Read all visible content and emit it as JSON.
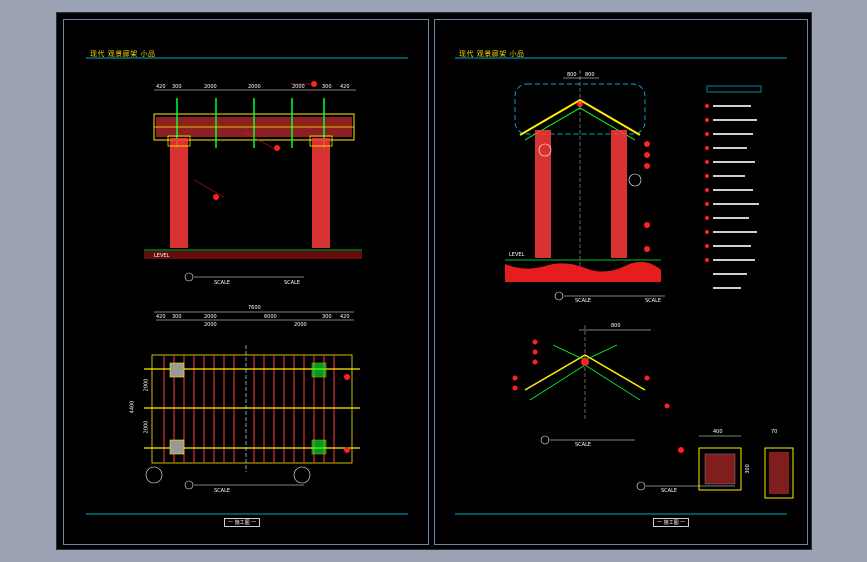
{
  "sheets": {
    "left": {
      "title_left": "现代 观景廊架 小品",
      "title_right": "",
      "elevation_dims_top": [
        "420",
        "300",
        "2000",
        "2000",
        "2000",
        "300",
        "420"
      ],
      "elevation_scale_label": "SCALE",
      "elevation_scale_label_2": "SCALE",
      "elevation_level": "LEVEL",
      "plan_dims_total": "7600",
      "plan_dims_top": [
        "420",
        "300",
        "2000",
        "6000",
        "300",
        "420"
      ],
      "plan_dims_sub": [
        "2000",
        "2000"
      ],
      "plan_left_dims": [
        "4400",
        "2000",
        "2000"
      ],
      "plan_scale_label": "SCALE",
      "footer": "一 施工图 一"
    },
    "right": {
      "title_left": "现代 观景廊架 小品",
      "title_right": "",
      "section_dims_top": [
        "800",
        "800"
      ],
      "section_level": "LEVEL",
      "section_scale_label": "SCALE",
      "section_scale_label_2": "SCALE",
      "detail_dim": "800",
      "detail_scale_label": "SCALE",
      "post_dims": [
        "400",
        "70"
      ],
      "post_side_dim": "300",
      "post_scale_label": "SCALE",
      "footer": "一 施工图 一"
    }
  },
  "colors": {
    "post_red": "#ff3b3b",
    "beam_yellow": "#ffee00",
    "line_green": "#00ff33",
    "outline_cyan": "#00e5ff",
    "marker_red": "#ff2020",
    "frame_blue": "#6b86a6"
  }
}
